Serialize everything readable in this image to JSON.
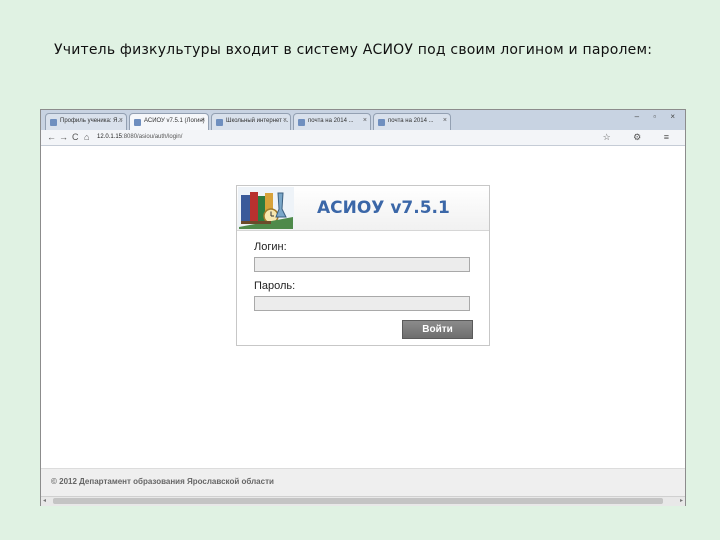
{
  "caption": "Учитель физкультуры входит в систему АСИОУ под своим логином и паролем:",
  "browser": {
    "tabs": [
      {
        "label": "Профиль ученика: Я...",
        "active": false
      },
      {
        "label": "АСИОУ v7.5.1 (Логин)",
        "active": true
      },
      {
        "label": "Школьный интернет ...",
        "active": false
      },
      {
        "label": "почта на 2014 ...",
        "active": false
      },
      {
        "label": "почта на 2014 ...",
        "active": false
      }
    ],
    "tab_close": "×",
    "window_controls": "– ▫ ×",
    "nav": {
      "back": "←",
      "forward": "→",
      "reload": "C",
      "home": "⌂"
    },
    "url_host": "12.0.1.15",
    "url_path": ":8080/asiou/auth/login/",
    "toolbar_icons": "☆ ⚙ ≡"
  },
  "login": {
    "app_title": "АСИОУ v7.5.1",
    "login_label": "Логин:",
    "login_value": "",
    "password_label": "Пароль:",
    "password_value": "",
    "submit_label": "Войти"
  },
  "footer": {
    "text": "© 2012 Департамент образования Ярославской области"
  },
  "scrollbar": {
    "left_arrow": "◂",
    "right_arrow": "▸"
  }
}
